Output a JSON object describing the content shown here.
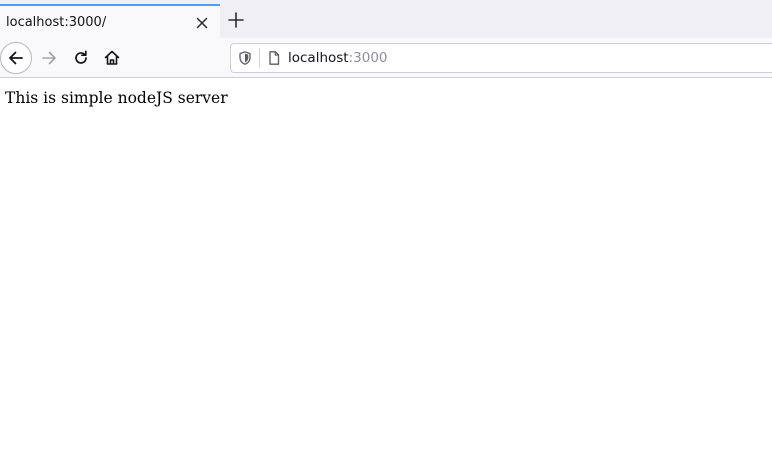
{
  "tab": {
    "title": "localhost:3000/"
  },
  "urlbar": {
    "host": "localhost",
    "port": ":3000"
  },
  "page": {
    "text": "This is simple nodeJS server"
  },
  "colors": {
    "tab_accent": "#45a1ff",
    "tabstrip_bg": "#f0f0f4",
    "toolbar_bg": "#f9f9fb"
  },
  "icons": {
    "tab_close": "close-icon",
    "new_tab": "plus-icon",
    "back": "arrow-left-icon",
    "forward": "arrow-right-icon",
    "reload": "reload-icon",
    "home": "home-icon",
    "tracking": "shield-icon",
    "page": "page-icon"
  }
}
